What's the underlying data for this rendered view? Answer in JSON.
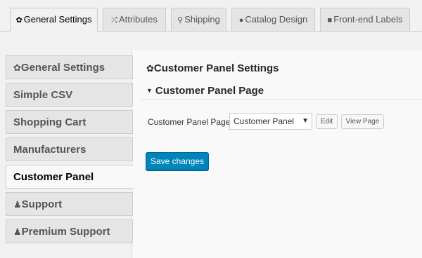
{
  "top_tabs": [
    {
      "label": "General Settings",
      "icon": "gear-icon",
      "glyph": "✿"
    },
    {
      "label": "Attributes",
      "icon": "shuffle-icon",
      "glyph": "⤮"
    },
    {
      "label": "Shipping",
      "icon": "location-pin-icon",
      "glyph": "⚲"
    },
    {
      "label": "Catalog Design",
      "icon": "palette-icon",
      "glyph": "●"
    },
    {
      "label": "Front-end Labels",
      "icon": "comment-icon",
      "glyph": "■"
    }
  ],
  "sidebar": {
    "items": [
      {
        "label": "General Settings",
        "icon": "gear-icon",
        "glyph": "✿"
      },
      {
        "label": "Simple CSV"
      },
      {
        "label": "Shopping Cart"
      },
      {
        "label": "Manufacturers"
      },
      {
        "label": "Customer Panel"
      },
      {
        "label": "Support",
        "icon": "person-icon",
        "glyph": "♟"
      },
      {
        "label": "Premium Support",
        "icon": "person-icon",
        "glyph": "♟"
      }
    ],
    "active_index": 4
  },
  "main": {
    "section_title": "Customer Panel Settings",
    "section_icon": "gear-icon",
    "section_glyph": "✿",
    "subsection_title": "Customer Panel Page",
    "caret_glyph": "▼",
    "field_label": "Customer Panel Page",
    "select_value": "Customer Panel",
    "select_arrow": "▼",
    "edit_label": "Edit",
    "view_page_label": "View Page",
    "save_label": "Save changes"
  },
  "colors": {
    "accent": "#0085ba",
    "tab_bg": "#e5e5e5",
    "panel_bg": "#f9f9f9"
  }
}
